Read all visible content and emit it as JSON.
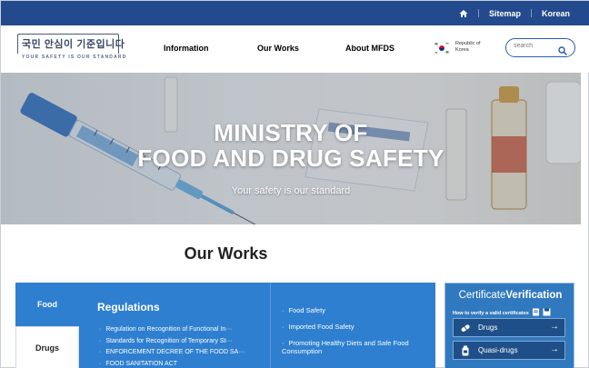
{
  "topbar": {
    "sitemap": "Sitemap",
    "language": "Korean",
    "bg": "#234a8c"
  },
  "header": {
    "logo_kr": "국민 안심이 기준입니다",
    "logo_en": "YOUR SAFETY IS OUR STANDARD",
    "nav": [
      "Information",
      "Our Works",
      "About MFDS"
    ],
    "country_line1": "Republic of",
    "country_line2": "Korea",
    "search_placeholder": "search"
  },
  "hero": {
    "title_line1": "MINISTRY OF",
    "title_line2": "FOOD AND DRUG SAFETY",
    "subtitle": "Your safety is our standard"
  },
  "works": {
    "title": "Our Works",
    "tabs": [
      "Food",
      "Drugs"
    ],
    "section_title": "Regulations",
    "regulations": [
      "Regulation on Recognition of Functional In···",
      "Standards for Recognition of Temporary St···",
      "ENFORCEMENT DECREE OF THE FOOD SA···",
      "FOOD SANITATION ACT"
    ],
    "topics": [
      "Food Safety",
      "Imported Food Safety",
      "Promoting Healthy Diets and Safe Food Consumption"
    ]
  },
  "certificate": {
    "title_normal": "Certificate",
    "title_bold": "Verification",
    "how_to": "How to verify a valid certificates",
    "buttons": [
      {
        "label": "Drugs",
        "icon": "pill-icon"
      },
      {
        "label": "Quasi-drugs",
        "icon": "bottle-icon"
      }
    ]
  },
  "colors": {
    "primary": "#2e7fd0",
    "navy": "#234a8c"
  }
}
